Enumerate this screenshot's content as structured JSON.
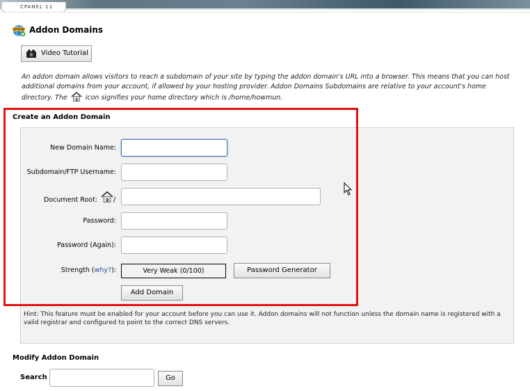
{
  "header": {
    "breadcrumb": "CPANEL 11"
  },
  "page": {
    "title": "Addon Domains",
    "video_button": "Video Tutorial",
    "description_part1": "An addon domain allows visitors to reach a subdomain of your site by typing the addon domain's URL into a browser. This means that you can host additional domains from your account, if allowed by your hosting provider. Addon Domains Subdomains are relative to your account's home directory. The",
    "description_part2": "icon signifies your home directory which is /home/howmun."
  },
  "create_form": {
    "section_title": "Create an Addon Domain",
    "labels": {
      "new_domain": "New Domain Name:",
      "subdomain": "Subdomain/FTP Username:",
      "doc_root": "Document Root:",
      "doc_root_slash": "/",
      "password": "Password:",
      "password_again": "Password (Again):",
      "strength_prefix": "Strength (",
      "strength_link": "why?",
      "strength_suffix": "):"
    },
    "values": {
      "new_domain": "",
      "subdomain": "",
      "doc_root": "",
      "password": "",
      "password_again": ""
    },
    "strength_value": "Very Weak (0/100)",
    "password_generator_button": "Password Generator",
    "add_domain_button": "Add Domain",
    "hint": "Hint: This feature must be enabled for your account before you can use it. Addon domains will not function unless the domain name is registered with a valid registrar and configured to point to the correct DNS servers."
  },
  "modify": {
    "section_title": "Modify Addon Domain",
    "search_label": "Search",
    "search_value": "",
    "go_button": "Go"
  },
  "colors": {
    "highlight_frame": "#e01313",
    "link": "#1a4e9b",
    "panel_bg": "#f2f2f2"
  },
  "icons": [
    "www-globe-icon",
    "video-camera-icon",
    "home-icon",
    "mouse-cursor-icon"
  ]
}
